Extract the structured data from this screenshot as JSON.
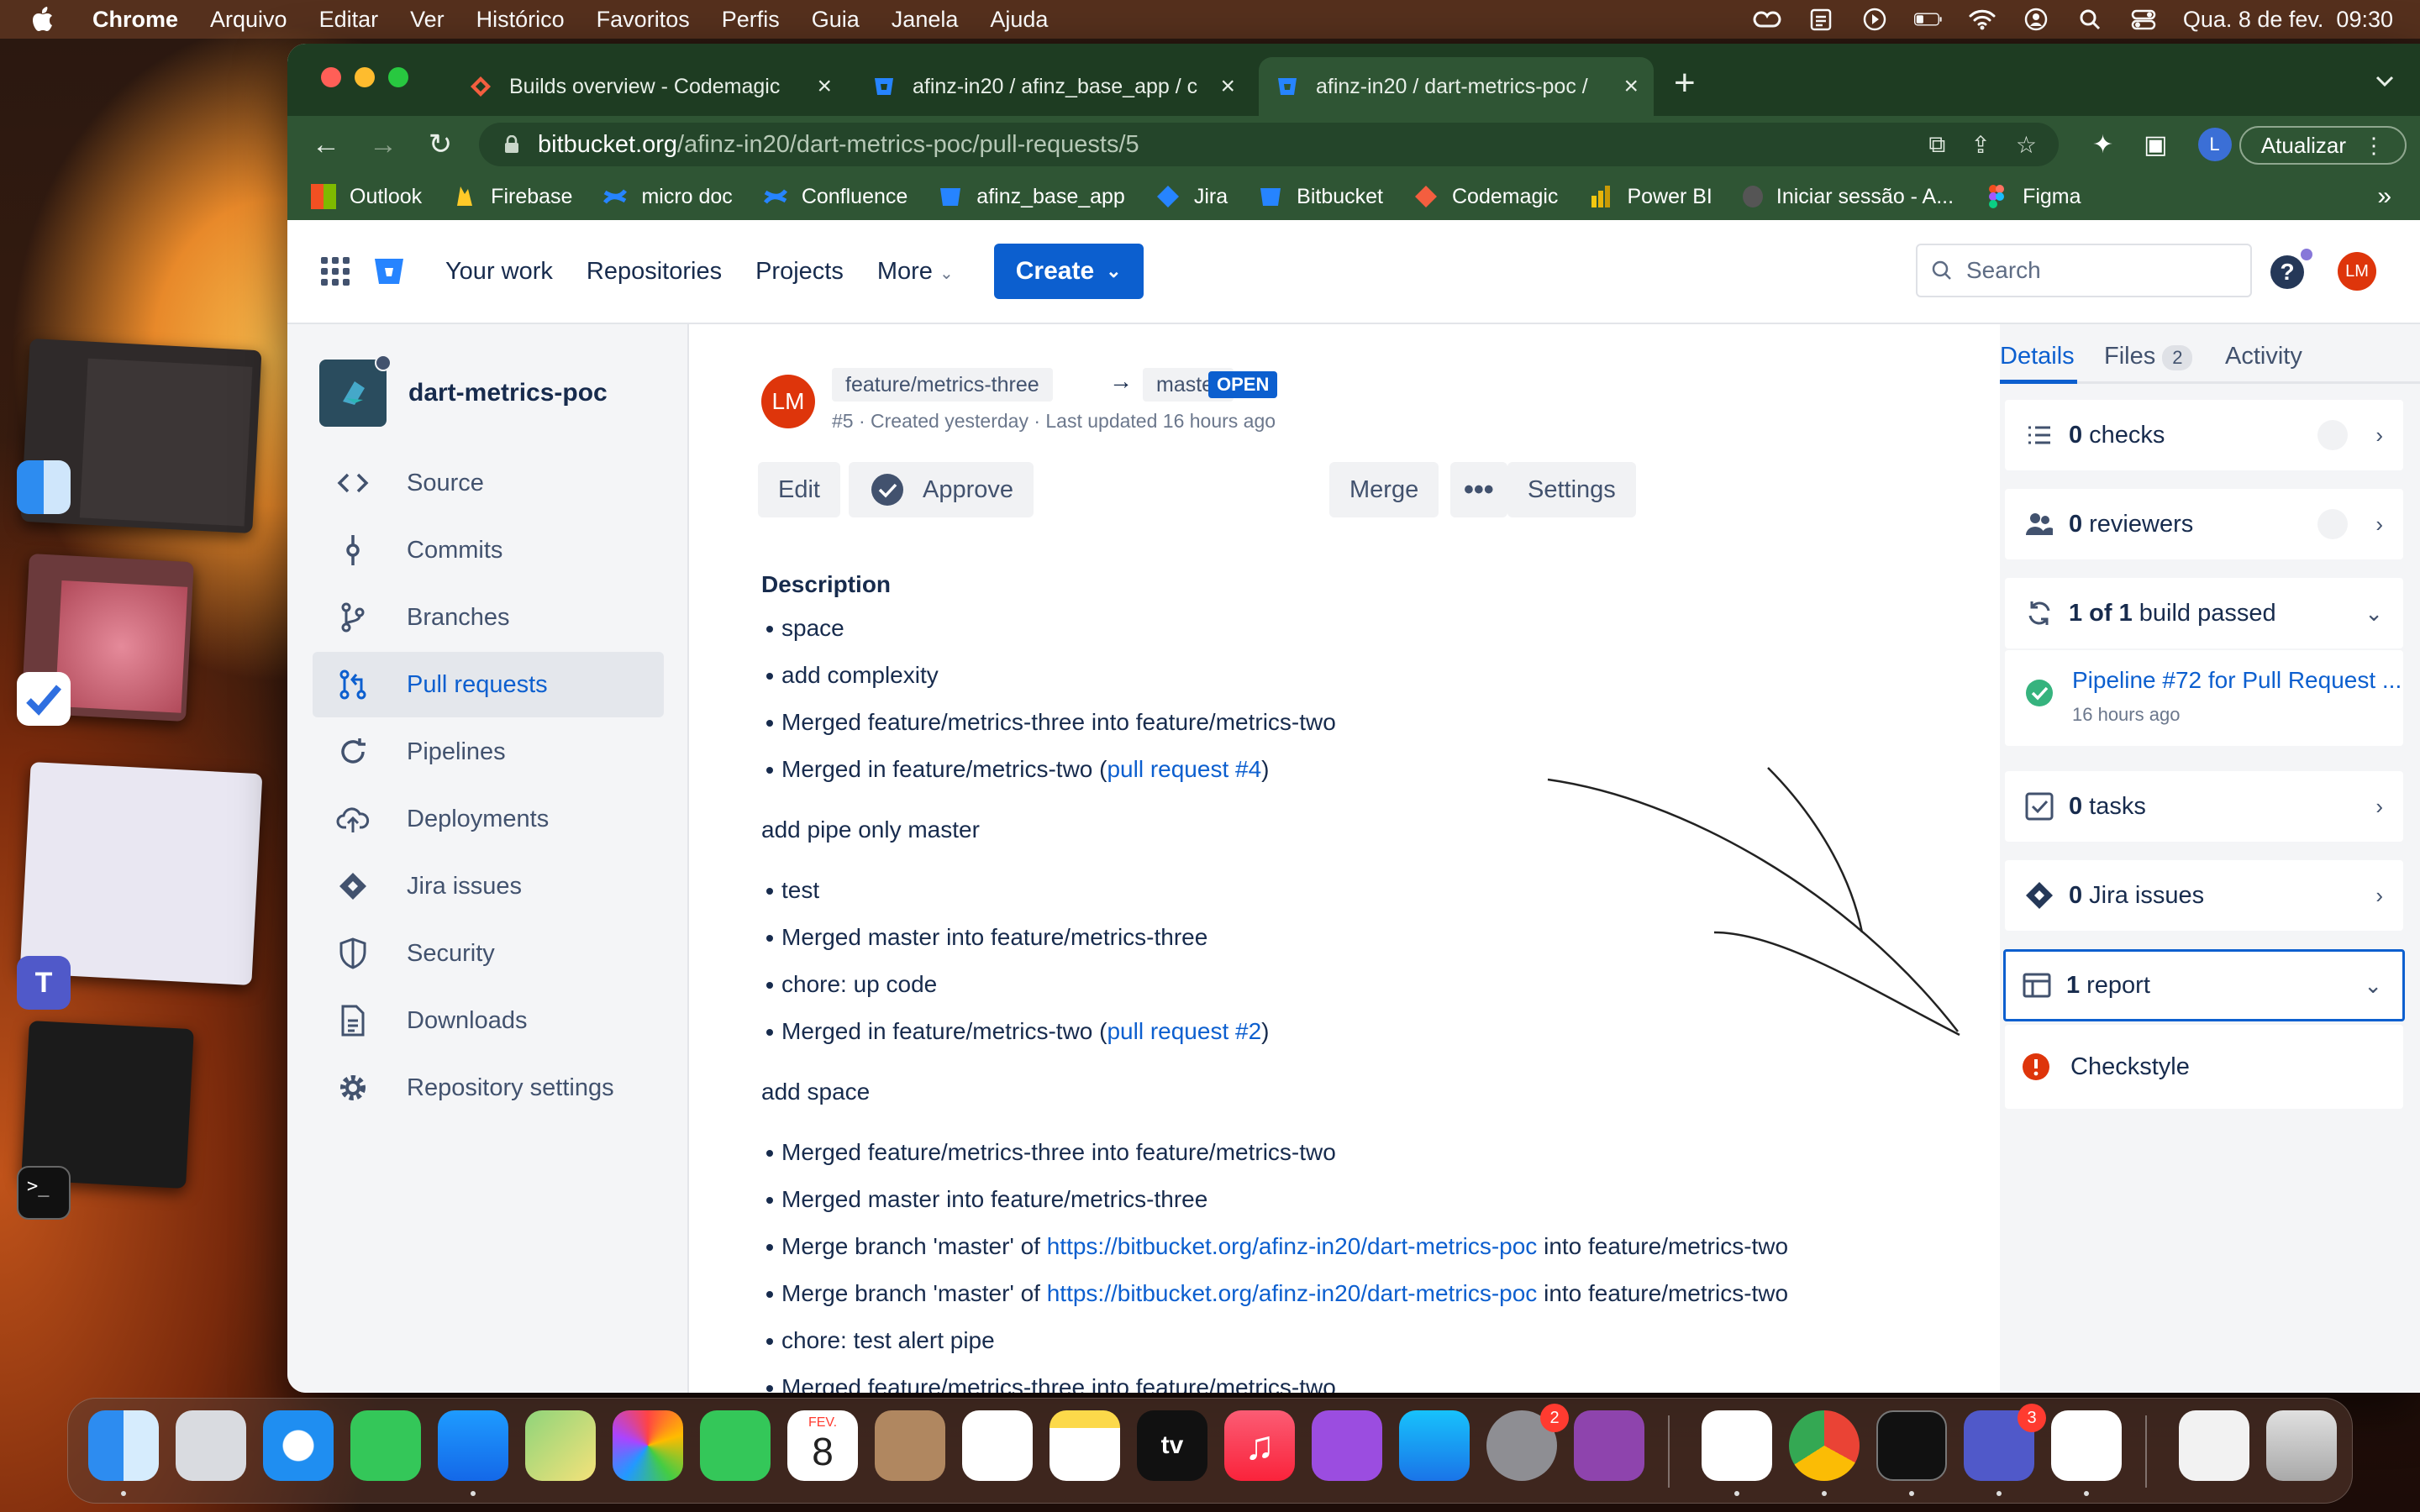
{
  "menubar": {
    "app": "Chrome",
    "items": [
      "Arquivo",
      "Editar",
      "Ver",
      "Histórico",
      "Favoritos",
      "Perfis",
      "Guia",
      "Janela",
      "Ajuda"
    ],
    "datetime": "Qua. 8 de fev.  09:30"
  },
  "tabs": [
    {
      "title": "Builds overview - Codemagic",
      "icon": "codemagic-icon"
    },
    {
      "title": "afinz-in20 / afinz_base_app / c",
      "icon": "bitbucket-icon"
    },
    {
      "title": "afinz-in20 / dart-metrics-poc /",
      "icon": "bitbucket-icon"
    }
  ],
  "toolbar": {
    "url_host": "bitbucket.org",
    "url_path": "/afinz-in20/dart-metrics-poc/pull-requests/5",
    "profile_initial": "L",
    "update_label": "Atualizar"
  },
  "bookmarks": [
    "Outlook",
    "Firebase",
    "micro doc",
    "Confluence",
    "afinz_base_app",
    "Jira",
    "Bitbucket",
    "Codemagic",
    "Power BI",
    "Iniciar sessão - A...",
    "Figma"
  ],
  "bbnav": {
    "links": [
      "Your work",
      "Repositories",
      "Projects",
      "More"
    ],
    "create_label": "Create",
    "search_placeholder": "Search",
    "user_initials": "LM"
  },
  "sidebar": {
    "repo_name": "dart-metrics-poc",
    "items": [
      {
        "label": "Source",
        "icon": "code-icon"
      },
      {
        "label": "Commits",
        "icon": "commit-icon"
      },
      {
        "label": "Branches",
        "icon": "branch-icon"
      },
      {
        "label": "Pull requests",
        "icon": "pull-request-icon"
      },
      {
        "label": "Pipelines",
        "icon": "pipelines-icon"
      },
      {
        "label": "Deployments",
        "icon": "cloud-upload-icon"
      },
      {
        "label": "Jira issues",
        "icon": "jira-icon"
      },
      {
        "label": "Security",
        "icon": "shield-icon"
      },
      {
        "label": "Downloads",
        "icon": "document-icon"
      },
      {
        "label": "Repository settings",
        "icon": "gear-icon"
      }
    ]
  },
  "pr": {
    "author_initials": "LM",
    "source_branch": "feature/metrics-three",
    "target_branch": "master",
    "status": "OPEN",
    "meta": "#5 · Created yesterday · Last updated 16 hours ago",
    "buttons": {
      "edit": "Edit",
      "approve": "Approve",
      "merge": "Merge",
      "settings": "Settings"
    },
    "description_heading": "Description",
    "list1": [
      "space",
      "add complexity",
      "Merged feature/metrics-three into feature/metrics-two"
    ],
    "list1_last": {
      "prefix": "Merged in feature/metrics-two (",
      "link": "pull request #4",
      "suffix": ")"
    },
    "para1": "add pipe only master",
    "list2": [
      "test",
      "Merged master into feature/metrics-three",
      "chore: up code"
    ],
    "list2_last": {
      "prefix": "Merged in feature/metrics-two (",
      "link": "pull request #2",
      "suffix": ")"
    },
    "para2": "add space",
    "list3": [
      "Merged feature/metrics-three into feature/metrics-two",
      "Merged master into feature/metrics-three"
    ],
    "merge_branch": {
      "prefix": "Merge branch 'master' of ",
      "link": "https://bitbucket.org/afinz-in20/dart-metrics-poc",
      "suffix": " into feature/metrics-two"
    },
    "list3_tail": [
      "chore: test alert pipe",
      "Merged feature/metrics-three into feature/metrics-two"
    ]
  },
  "details": {
    "tabs": {
      "details": "Details",
      "files": "Files",
      "files_count": "2",
      "activity": "Activity"
    },
    "checks": {
      "count": "0",
      "label": "checks"
    },
    "reviewers": {
      "count": "0",
      "label": "reviewers"
    },
    "builds": {
      "count": "1 of 1",
      "label": "build passed"
    },
    "pipeline": {
      "title": "Pipeline #72 for Pull Request ...",
      "time": "16 hours ago"
    },
    "tasks": {
      "count": "0",
      "label": "tasks"
    },
    "jira": {
      "count": "0",
      "label": "Jira issues"
    },
    "reports": {
      "count": "1",
      "label": "report"
    },
    "checkstyle": "Checkstyle"
  },
  "dock": {
    "calendar_month": "FEV.",
    "calendar_day": "8",
    "badges": {
      "settings": "2",
      "teams": "3"
    }
  },
  "colors": {
    "accent": "#0c5fcf",
    "open_badge": "#0c5fcf",
    "success": "#36b37e",
    "error": "#de350b"
  }
}
